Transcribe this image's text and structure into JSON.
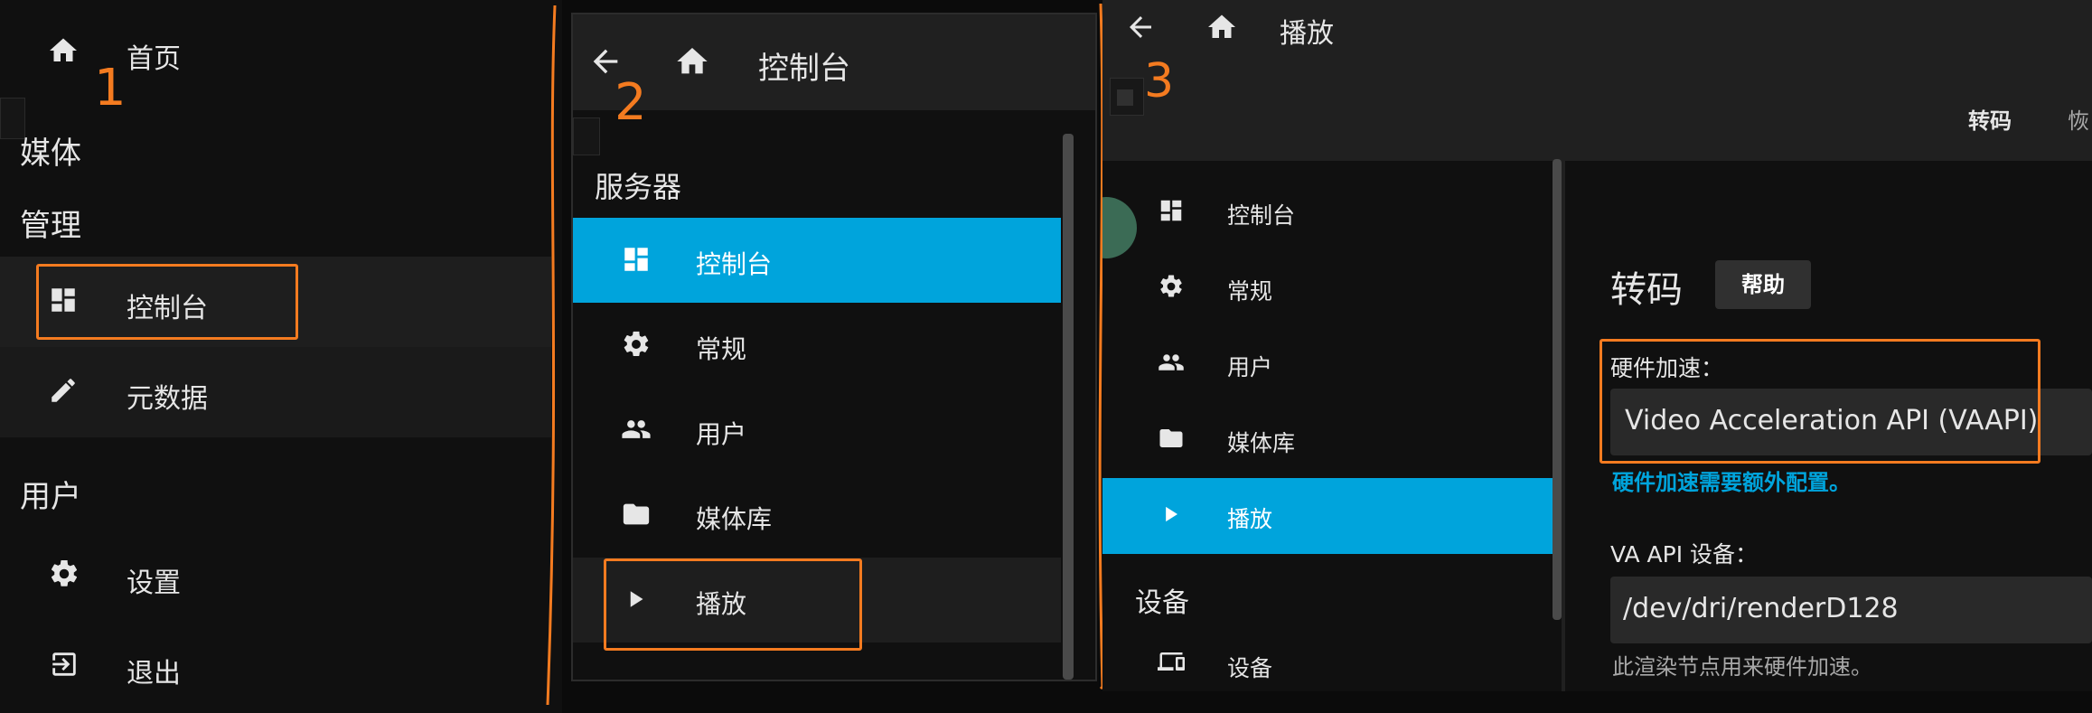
{
  "panel1": {
    "home_label": "首页",
    "section_media": "媒体",
    "section_admin": "管理",
    "dashboard_label": "控制台",
    "metadata_label": "元数据",
    "section_user": "用户",
    "settings_label": "设置",
    "logout_label": "退出",
    "step_number": "1"
  },
  "panel2": {
    "header_title": "控制台",
    "section_server": "服务器",
    "items": [
      {
        "label": "控制台",
        "icon": "dashboard-icon"
      },
      {
        "label": "常规",
        "icon": "gear-icon"
      },
      {
        "label": "用户",
        "icon": "users-icon"
      },
      {
        "label": "媒体库",
        "icon": "folder-icon"
      },
      {
        "label": "播放",
        "icon": "play-icon"
      }
    ],
    "step_number": "2"
  },
  "panel3": {
    "header_title": "播放",
    "step_number": "3",
    "tab_transcode": "转码",
    "tab_next_partial": "恢",
    "nav_items": [
      {
        "label": "控制台",
        "icon": "dashboard-icon"
      },
      {
        "label": "常规",
        "icon": "gear-icon"
      },
      {
        "label": "用户",
        "icon": "users-icon"
      },
      {
        "label": "媒体库",
        "icon": "folder-icon"
      },
      {
        "label": "播放",
        "icon": "play-icon"
      }
    ],
    "section_devices": "设备",
    "devices_item_label": "设备",
    "content": {
      "title": "转码",
      "help_button": "帮助",
      "hw_accel_label": "硬件加速：",
      "hw_accel_value": "Video Acceleration API (VAAPI)",
      "hw_accel_note": "硬件加速需要额外配置。",
      "vaapi_label": "VA API 设备：",
      "vaapi_value": "/dev/dri/renderD128",
      "vaapi_help": "此渲染节点用来硬件加速。"
    }
  },
  "colors": {
    "accent_blue": "#00a4dc",
    "highlight_orange": "#f47b20",
    "sidebar_bg": "#101010",
    "header_bg": "#202020"
  }
}
